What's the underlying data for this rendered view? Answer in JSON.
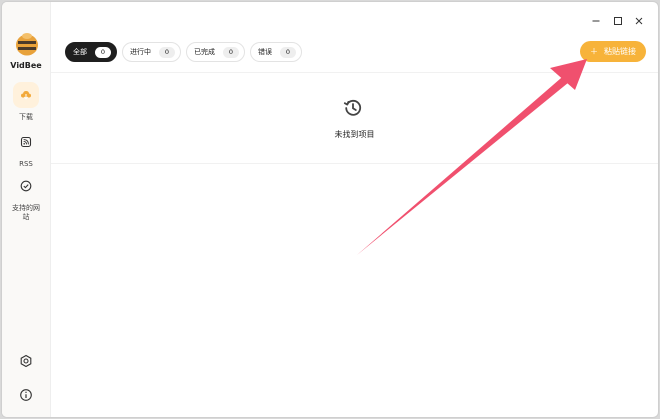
{
  "app": {
    "name": "VidBee",
    "brand_color": "#f7b33a"
  },
  "sidebar": {
    "items": [
      {
        "label": "下载",
        "icon": "download-icon",
        "active": true
      },
      {
        "label": "RSS",
        "icon": "rss-icon",
        "active": false
      },
      {
        "label": "支持的网站",
        "icon": "check-circle-icon",
        "active": false
      }
    ],
    "bottom": [
      {
        "icon": "settings-icon"
      },
      {
        "icon": "info-icon"
      }
    ]
  },
  "filters": [
    {
      "label": "全部",
      "count": "0",
      "active": true
    },
    {
      "label": "进行中",
      "count": "0",
      "active": false
    },
    {
      "label": "已完成",
      "count": "0",
      "active": false
    },
    {
      "label": "错误",
      "count": "0",
      "active": false
    }
  ],
  "toolbar": {
    "paste_label": "粘贴链接"
  },
  "empty_state": {
    "text": "未找到项目",
    "icon": "history-icon"
  },
  "annotation": {
    "arrow_color": "#f0506e"
  }
}
